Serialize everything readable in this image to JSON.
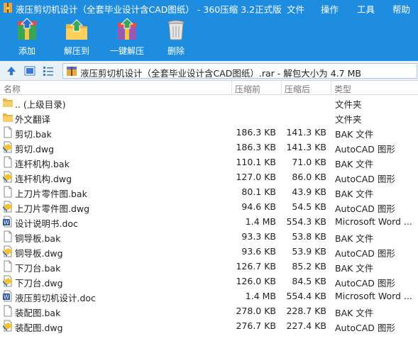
{
  "window": {
    "title": "液压剪切机设计（全套毕业设计含CAD图纸） - 360压缩 3.2正式版",
    "menus": [
      "文件",
      "操作",
      "工具",
      "帮助"
    ]
  },
  "toolbar": {
    "add_label": "添加",
    "extract_to_label": "解压到",
    "one_click_extract_label": "一键解压",
    "delete_label": "删除"
  },
  "address": {
    "path": "液压剪切机设计（全套毕业设计含CAD图纸）.rar - 解包大小为 4.7 MB"
  },
  "columns": {
    "name": "名称",
    "size": "压缩前",
    "compressed": "压缩后",
    "type": "类型"
  },
  "files": [
    {
      "name": ".. (上级目录)",
      "size": "",
      "compressed": "",
      "type": "文件夹",
      "icon": "folder-icon"
    },
    {
      "name": "外文翻译",
      "size": "",
      "compressed": "",
      "type": "文件夹",
      "icon": "folder-icon"
    },
    {
      "name": "剪切.bak",
      "size": "186.3 KB",
      "compressed": "141.3 KB",
      "type": "BAK 文件",
      "icon": "blank-file-icon"
    },
    {
      "name": "剪切.dwg",
      "size": "186.3 KB",
      "compressed": "141.3 KB",
      "type": "AutoCAD 图形",
      "icon": "dwg-file-icon"
    },
    {
      "name": "连杆机构.bak",
      "size": "110.1 KB",
      "compressed": "71.0 KB",
      "type": "BAK 文件",
      "icon": "blank-file-icon"
    },
    {
      "name": "连杆机构.dwg",
      "size": "127.0 KB",
      "compressed": "86.0 KB",
      "type": "AutoCAD 图形",
      "icon": "dwg-file-icon"
    },
    {
      "name": "上刀片零件图.bak",
      "size": "80.1 KB",
      "compressed": "43.9 KB",
      "type": "BAK 文件",
      "icon": "blank-file-icon"
    },
    {
      "name": "上刀片零件图.dwg",
      "size": "94.6 KB",
      "compressed": "54.5 KB",
      "type": "AutoCAD 图形",
      "icon": "dwg-file-icon"
    },
    {
      "name": "设计说明书.doc",
      "size": "1.4 MB",
      "compressed": "554.3 KB",
      "type": "Microsoft Word ...",
      "icon": "word-file-icon"
    },
    {
      "name": "铜导板.bak",
      "size": "93.3 KB",
      "compressed": "53.8 KB",
      "type": "BAK 文件",
      "icon": "blank-file-icon"
    },
    {
      "name": "铜导板.dwg",
      "size": "93.6 KB",
      "compressed": "53.9 KB",
      "type": "AutoCAD 图形",
      "icon": "dwg-file-icon"
    },
    {
      "name": "下刀台.bak",
      "size": "126.7 KB",
      "compressed": "85.2 KB",
      "type": "BAK 文件",
      "icon": "blank-file-icon"
    },
    {
      "name": "下刀台.dwg",
      "size": "126.0 KB",
      "compressed": "84.5 KB",
      "type": "AutoCAD 图形",
      "icon": "dwg-file-icon"
    },
    {
      "name": "液压剪切机设计.doc",
      "size": "1.4 MB",
      "compressed": "554.4 KB",
      "type": "Microsoft Word ...",
      "icon": "word-file-icon"
    },
    {
      "name": "装配图.bak",
      "size": "278.0 KB",
      "compressed": "228.7 KB",
      "type": "BAK 文件",
      "icon": "blank-file-icon"
    },
    {
      "name": "装配图.dwg",
      "size": "276.7 KB",
      "compressed": "227.4 KB",
      "type": "AutoCAD 图形",
      "icon": "dwg-file-icon"
    }
  ],
  "colors": {
    "accent": "#1e8de0"
  }
}
